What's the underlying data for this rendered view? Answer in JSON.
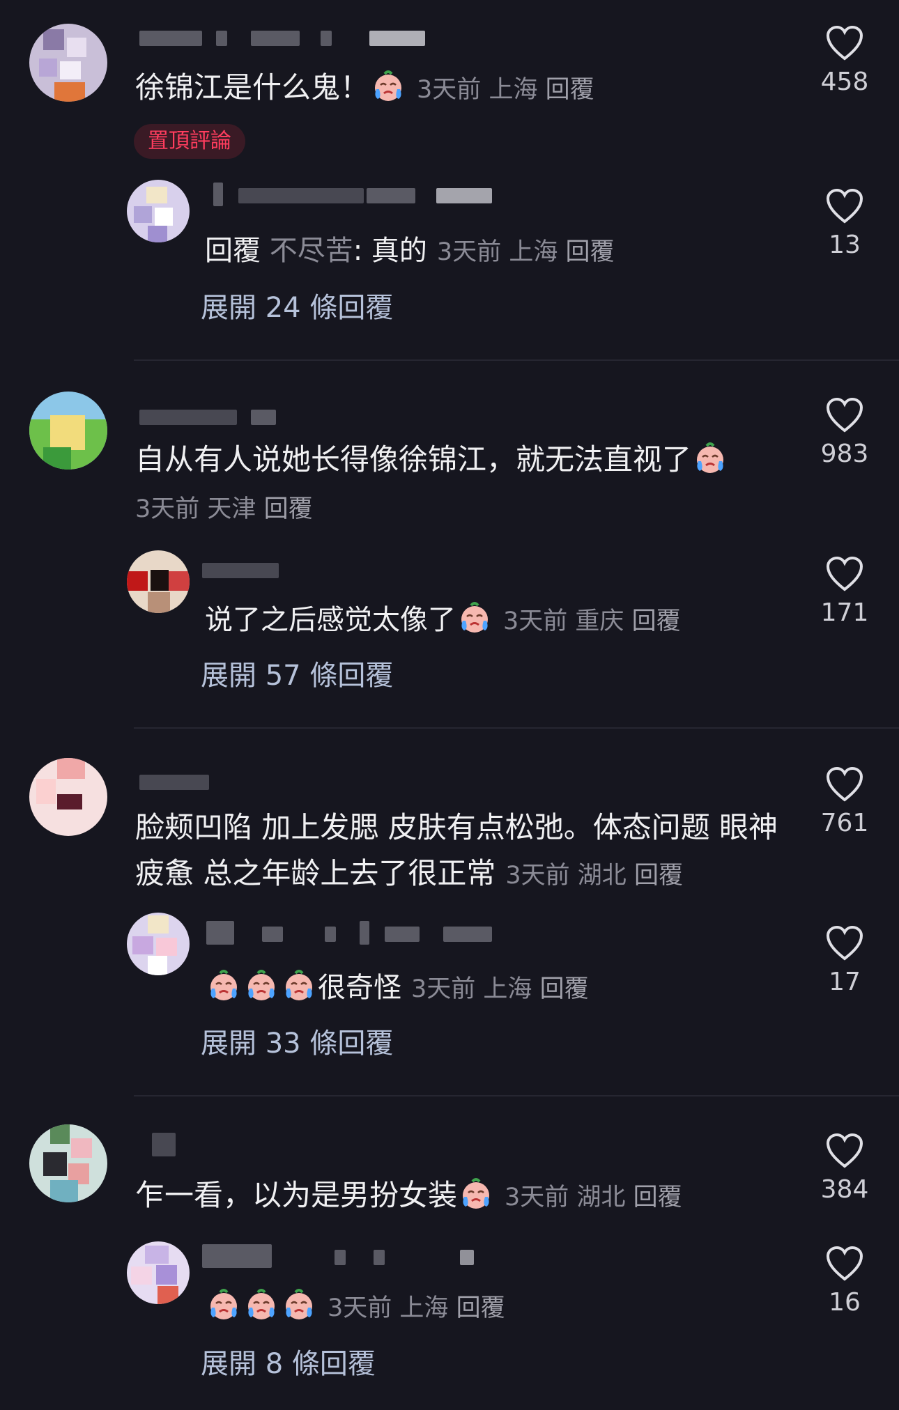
{
  "colors": {
    "background": "#16161f",
    "text": "#f0f0f2",
    "meta": "#8b8b96",
    "expand_link": "#b6c2da",
    "pin_text": "#ff3d5e",
    "pin_bg": "#3a1a25"
  },
  "threads": [
    {
      "comment": {
        "text": "徐锦江是什么鬼！",
        "emoji": "crying-face-emoji",
        "time": "3天前",
        "location": "上海",
        "reply_label": "回覆",
        "likes": "458"
      },
      "pinned_label": "置頂評論",
      "reply": {
        "prefix": "回覆",
        "quoted_user": "不尽苦",
        "text": ": 真的",
        "time": "3天前",
        "location": "上海",
        "reply_label": "回覆",
        "likes": "13"
      },
      "expand_label": "展開 24 條回覆"
    },
    {
      "comment": {
        "text": "自从有人说她长得像徐锦江，就无法直视了",
        "emoji": "crying-face-emoji",
        "time": "3天前",
        "location": "天津",
        "reply_label": "回覆",
        "likes": "983"
      },
      "reply": {
        "text": "说了之后感觉太像了",
        "time": "3天前",
        "location": "重庆",
        "reply_label": "回覆",
        "likes": "171"
      },
      "expand_label": "展開 57 條回覆"
    },
    {
      "comment": {
        "text_line1": "脸颊凹陷 加上发腮 皮肤有点松弛。体态问题 眼神",
        "text_line2": "疲惫 总之年龄上去了很正常",
        "time": "3天前",
        "location": "湖北",
        "reply_label": "回覆",
        "likes": "761"
      },
      "reply": {
        "text": "很奇怪",
        "time": "3天前",
        "location": "上海",
        "reply_label": "回覆",
        "likes": "17"
      },
      "expand_label": "展開 33 條回覆"
    },
    {
      "comment": {
        "text": "乍一看，以为是男扮女装",
        "time": "3天前",
        "location": "湖北",
        "reply_label": "回覆",
        "likes": "384"
      },
      "reply": {
        "time": "3天前",
        "location": "上海",
        "reply_label": "回覆",
        "likes": "16"
      },
      "expand_label": "展開 8 條回覆"
    }
  ]
}
